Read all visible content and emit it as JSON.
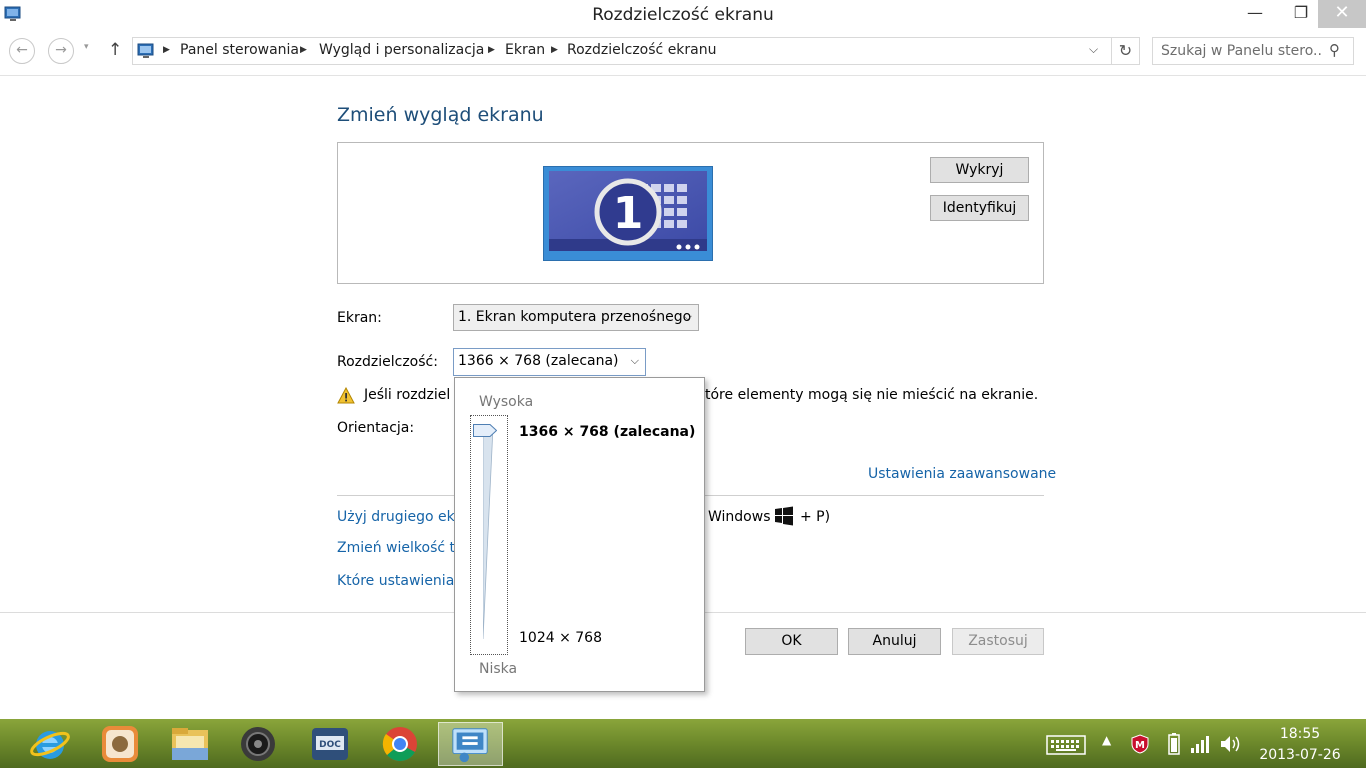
{
  "window": {
    "title": "Rozdzielczość ekranu",
    "minimize_glyph": "—",
    "maximize_glyph": "❐",
    "close_glyph": "✕"
  },
  "nav": {
    "back_glyph": "←",
    "forward_glyph": "→",
    "recent_glyph": "▾",
    "up_glyph": "↑",
    "breadcrumbs": [
      "Panel sterowania",
      "Wygląd i personalizacja",
      "Ekran",
      "Rozdzielczość ekranu"
    ],
    "crumb_separator": "▶",
    "dropdown_glyph": "⌵",
    "refresh_glyph": "↻",
    "search_placeholder": "Szukaj w Panelu stero...",
    "search_glyph": "⚲"
  },
  "main": {
    "title": "Zmień wygląd ekranu",
    "monitor_number": "1",
    "detect_label": "Wykryj",
    "identify_label": "Identyfikuj",
    "screen_label": "Ekran:",
    "screen_value": "1. Ekran komputera przenośnego",
    "resolution_label": "Rozdzielczość:",
    "resolution_value": "1366 × 768 (zalecana)",
    "select_arrow": "⌵",
    "warning_text_left": "Jeśli rozdziel",
    "warning_text_right": "tóre elementy mogą się nie mieścić na ekranie.",
    "orientation_label": "Orientacja:",
    "advanced_link": "Ustawienia zaawansowane",
    "link_second_screen": "Użyj drugiego ekr",
    "link_text_size": "Zmień wielkość te",
    "link_which_settings": "Które ustawienia",
    "shortcut_text": "Windows",
    "shortcut_tail": "+ P)",
    "ok_label": "OK",
    "cancel_label": "Anuluj",
    "apply_label": "Zastosuj"
  },
  "resolution_popup": {
    "high_label": "Wysoka",
    "low_label": "Niska",
    "top_value": "1366 × 768 (zalecana)",
    "bottom_value": "1024 × 768",
    "slider_level": 1.0
  },
  "taskbar": {
    "apps": [
      "ie-icon",
      "app-icon",
      "file-explorer-icon",
      "speaker-app-icon",
      "doc-app-icon",
      "chrome-icon",
      "control-panel-icon"
    ],
    "tray_arrow": "▲",
    "time": "18:55",
    "date": "2013-07-26"
  },
  "colors": {
    "link": "#1664a8",
    "title": "#1e4e79",
    "taskbar": "#6f8b2c"
  }
}
